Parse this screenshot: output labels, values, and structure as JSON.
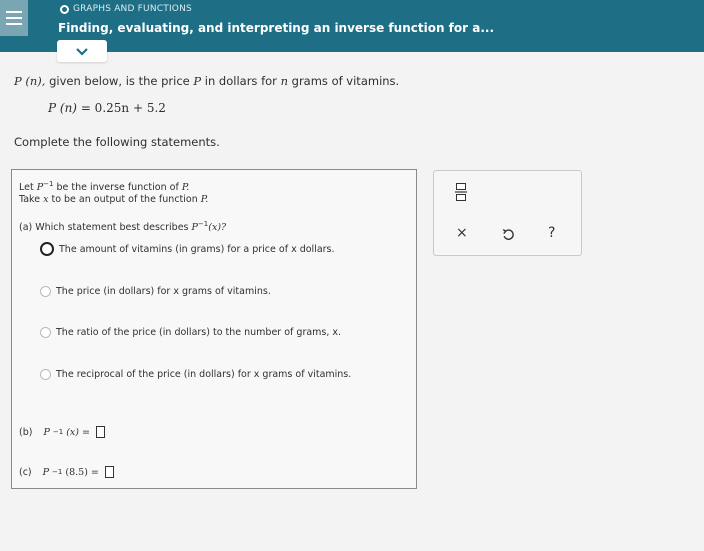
{
  "header": {
    "topic": "GRAPHS AND FUNCTIONS",
    "title": "Finding, evaluating, and interpreting an inverse function for a..."
  },
  "question": {
    "intro_fn": "P (n),",
    "intro_text": " given below, is the price ",
    "intro_P": "P",
    "intro_text2": " in dollars for ",
    "intro_n": "n",
    "intro_text3": " grams of vitamins.",
    "formula_lhs": "P (n)",
    "formula_rhs": "= 0.25n + 5.2",
    "instruction": "Complete the following statements."
  },
  "panel": {
    "let_prefix": "Let ",
    "let_fn": "P",
    "let_sup": "−1",
    "let_suffix": " be the inverse function of ",
    "let_P": "P.",
    "take_prefix": "Take ",
    "take_x": "x",
    "take_suffix": " to be an output of the function ",
    "take_P": "P.",
    "part_a_label": "(a)  Which statement best describes ",
    "part_a_fn": "P",
    "part_a_sup": "−1",
    "part_a_arg": "(x)?",
    "options": [
      {
        "text": "The amount of vitamins (in grams) for a price of x dollars."
      },
      {
        "text": "The price (in dollars) for x grams of vitamins."
      },
      {
        "text": "The ratio of the price (in dollars) to the number of grams, x."
      },
      {
        "text": "The reciprocal of the price (in dollars) for x grams of vitamins."
      }
    ],
    "part_b_label": "(b)",
    "part_b_fn": "P",
    "part_b_sup": "−1",
    "part_b_arg": "(x)",
    "part_b_eq": "=",
    "part_c_label": "(c)",
    "part_c_fn": "P",
    "part_c_sup": "−1",
    "part_c_arg": "(8.5)",
    "part_c_eq": "="
  },
  "tools": {
    "fraction_icon": "fraction-icon",
    "clear": "×",
    "undo_icon": "undo-icon",
    "help": "?"
  },
  "colors": {
    "header_bg": "#1e6f86",
    "accent": "#1e6f86"
  }
}
